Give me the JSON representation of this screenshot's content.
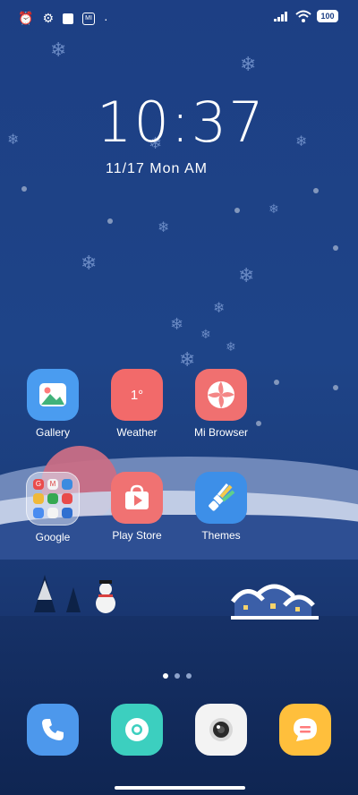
{
  "status_bar": {
    "battery": "100",
    "left_icons": [
      "alarm-off-icon",
      "settings-icon",
      "notification-square-icon",
      "mi-icon",
      "dot-icon"
    ],
    "right_icons": [
      "signal-icon",
      "wifi-icon",
      "battery-icon"
    ]
  },
  "clock": {
    "time": "10:37",
    "date": "11/17 Mon AM"
  },
  "apps": [
    {
      "label": "Gallery",
      "icon": "gallery-icon"
    },
    {
      "label": "Weather",
      "icon": "weather-icon",
      "badge": "1°"
    },
    {
      "label": "Mi Browser",
      "icon": "mi-browser-icon"
    },
    {
      "label": "Google",
      "icon": "google-folder-icon"
    },
    {
      "label": "Play Store",
      "icon": "play-store-icon"
    },
    {
      "label": "Themes",
      "icon": "themes-icon"
    }
  ],
  "dock": [
    "phone-icon",
    "chrome-icon",
    "camera-icon",
    "messages-icon"
  ],
  "page_indicator": {
    "pages": 3,
    "current": 1
  },
  "colors": {
    "background": "#1d3f84",
    "gallery": "#4a9cf0",
    "weather": "#f26a6a",
    "browser": "#f07070",
    "themes": "#3d8fe8",
    "play": "#f07272",
    "phone": "#4d98ec",
    "chrome": "#3ccfbf",
    "messages": "#ffbf3c"
  }
}
